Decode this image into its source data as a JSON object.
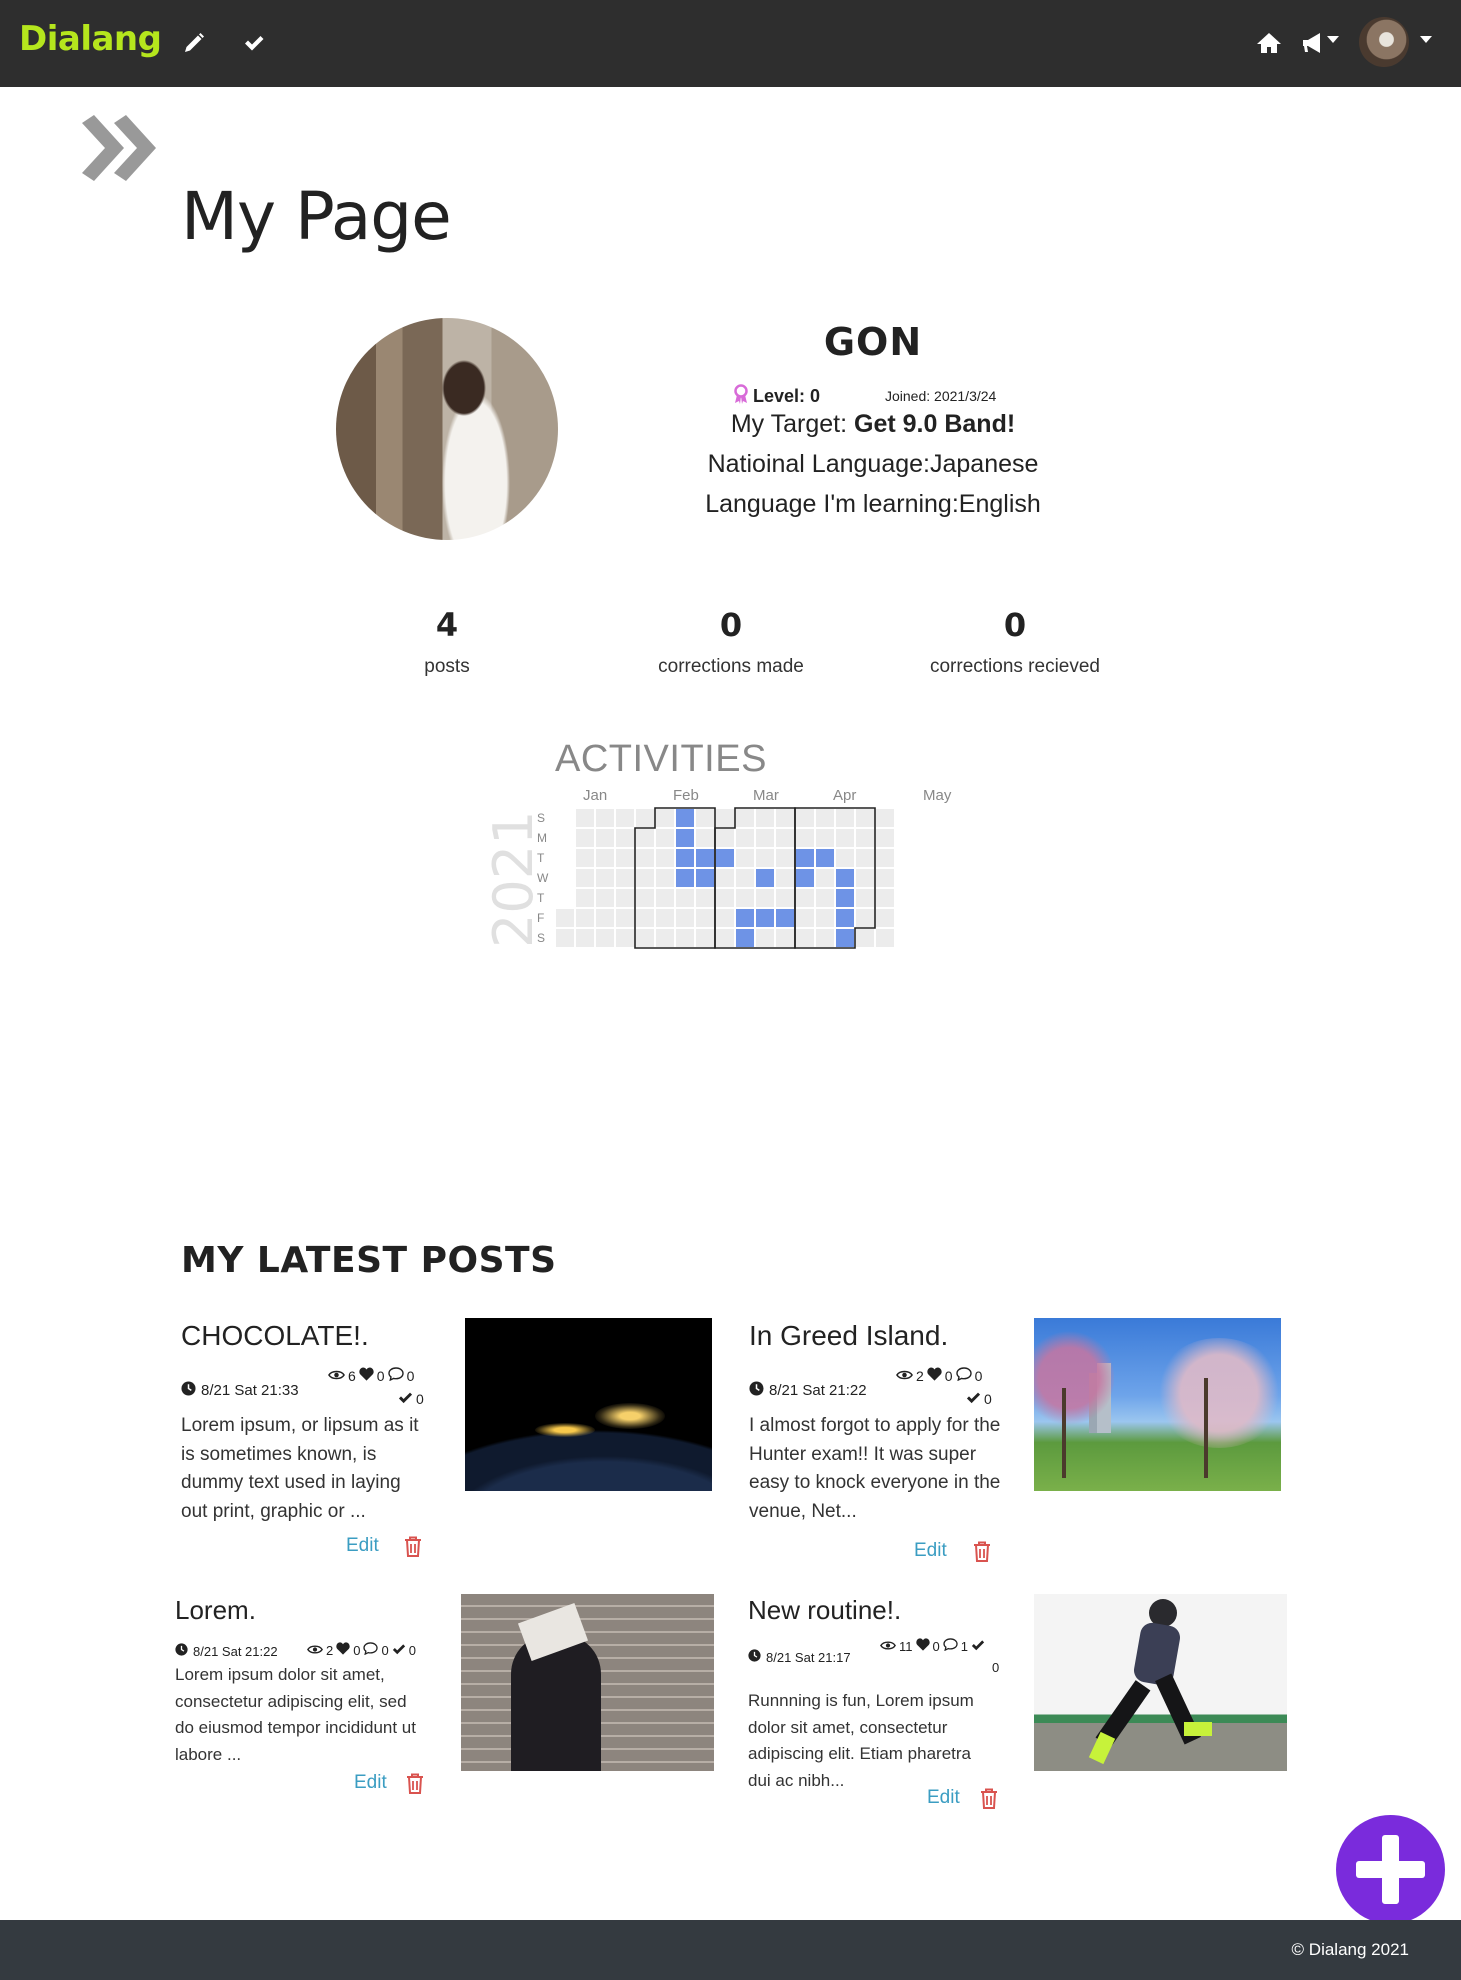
{
  "nav": {
    "brand": "Dialang",
    "brand_color": "#b5e61d",
    "icons": [
      "pencil-icon",
      "check-icon",
      "home-icon",
      "megaphone-icon"
    ]
  },
  "page": {
    "title": "My Page"
  },
  "profile": {
    "name": "GON",
    "level_label": "Level: 0",
    "joined": "Joined: 2021/3/24",
    "target_prefix": "My Target: ",
    "target_value": "Get 9.0 Band!",
    "national_language": "Natioinal Language:Japanese",
    "learning_language": "Language I'm learning:English"
  },
  "stats": [
    {
      "value": "4",
      "label": "posts"
    },
    {
      "value": "0",
      "label": "corrections made"
    },
    {
      "value": "0",
      "label": "corrections recieved"
    }
  ],
  "activities": {
    "title": "ACTIVITIES",
    "year": "2021",
    "months": [
      "Jan",
      "Feb",
      "Mar",
      "Apr",
      "May"
    ],
    "weekdays": [
      "S",
      "M",
      "T",
      "W",
      "T",
      "F",
      "S"
    ],
    "active_color": "#6e93e6"
  },
  "posts_heading": "MY LATEST POSTS",
  "posts": [
    {
      "title": "CHOCOLATE!.",
      "date": "8/21 Sat 21:33",
      "views": "6",
      "likes": "0",
      "comments": "0",
      "corrections": "0",
      "body": "Lorem ipsum, or lipsum as it is sometimes known, is dummy text used in laying out print, graphic or ...",
      "edit": "Edit",
      "image": "earth-at-night-image"
    },
    {
      "title": "In Greed Island.",
      "date": "8/21 Sat 21:22",
      "views": "2",
      "likes": "0",
      "comments": "0",
      "corrections": "0",
      "body": "I almost forgot to apply for the Hunter exam!! It was super easy to knock everyone in the venue, Net...",
      "edit": "Edit",
      "image": "blossom-trees-image"
    },
    {
      "title": "Lorem.",
      "date": "8/21 Sat 21:22",
      "views": "2",
      "likes": "0",
      "comments": "0",
      "corrections": "0",
      "body": "Lorem ipsum dolor sit amet, consectetur adipiscing elit, sed do eiusmod tempor incididunt ut labore ...",
      "edit": "Edit",
      "image": "person-reading-book-image"
    },
    {
      "title": "New routine!.",
      "date": "8/21 Sat 21:17",
      "views": "11",
      "likes": "0",
      "comments": "1",
      "corrections": "0",
      "body": "Runnning is fun, Lorem ipsum dolor sit amet, consectetur adipiscing elit. Etiam pharetra dui ac nibh...",
      "edit": "Edit",
      "image": "runner-image"
    }
  ],
  "footer": {
    "text": "© Dialang 2021"
  }
}
